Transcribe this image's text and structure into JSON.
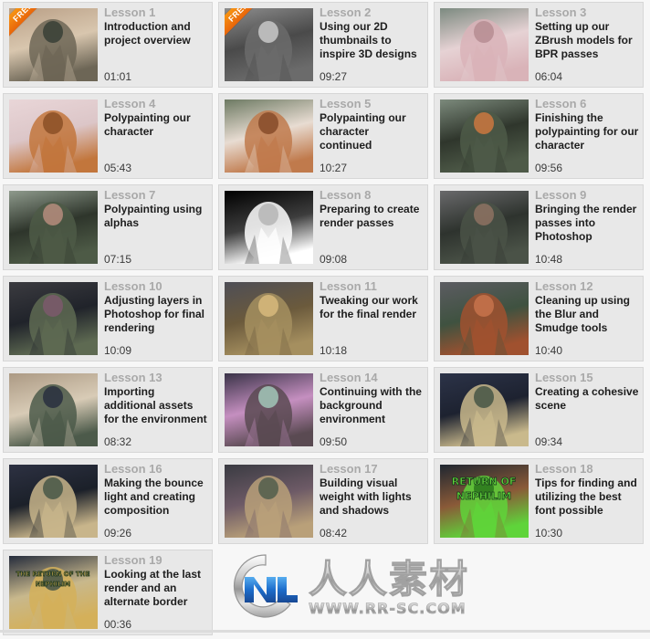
{
  "page": {
    "background_color": "#f7f7f7",
    "card_background": "#e8e8e8",
    "lesson_number_color": "#a9a9a9",
    "title_color": "#1e1e1e",
    "ribbon_color": "#ef7d10"
  },
  "free_badge_label": "FREE",
  "lessons": [
    {
      "number": "Lesson 1",
      "title": "Introduction and project overview",
      "duration": "01:01",
      "free": true,
      "thumb": "armored-creature-on-tan-sky",
      "palette": [
        "#b99f86",
        "#6d6656",
        "#3c4339",
        "#d8c6ae"
      ]
    },
    {
      "number": "Lesson 2",
      "title": "Using our 2D thumbnails to inspire 3D designs",
      "duration": "09:27",
      "free": true,
      "thumb": "grey-2d-weapon-thumbnails",
      "palette": [
        "#8d8d8d",
        "#6b6b6b",
        "#c3c3c3",
        "#4a4a4a"
      ]
    },
    {
      "number": "Lesson 3",
      "title": "Setting up our ZBrush models for BPR passes",
      "duration": "06:04",
      "free": false,
      "thumb": "pink-grey-zbrush-torso",
      "palette": [
        "#7c8a80",
        "#d9b3b8",
        "#b88f95",
        "#e6d2d4"
      ]
    },
    {
      "number": "Lesson 4",
      "title": "Polypainting our character",
      "duration": "05:43",
      "free": false,
      "thumb": "orange-creature-polypaint-ui",
      "palette": [
        "#e9d6d8",
        "#c2763c",
        "#8e5228",
        "#dcc6c8"
      ]
    },
    {
      "number": "Lesson 5",
      "title": "Polypainting our character continued",
      "duration": "10:27",
      "free": false,
      "thumb": "orange-creature-head-closeup",
      "palette": [
        "#6d7a63",
        "#c07a4c",
        "#8a4f2c",
        "#e8dcd2"
      ]
    },
    {
      "number": "Lesson 6",
      "title": "Finishing the polypainting for our character",
      "duration": "09:56",
      "free": false,
      "thumb": "green-armor-torso",
      "palette": [
        "#7c8a7c",
        "#4e5a48",
        "#c4763f",
        "#2f362c"
      ]
    },
    {
      "number": "Lesson 7",
      "title": "Polypainting using alphas",
      "duration": "07:15",
      "free": false,
      "thumb": "green-armor-torso-alphas",
      "palette": [
        "#8e9a8c",
        "#4d5a46",
        "#b0897a",
        "#2e352b"
      ]
    },
    {
      "number": "Lesson 8",
      "title": "Preparing to create render passes",
      "duration": "09:08",
      "free": false,
      "thumb": "black-white-render-pass",
      "palette": [
        "#000000",
        "#ffffff",
        "#b8b8b8",
        "#3d3d3d"
      ]
    },
    {
      "number": "Lesson 9",
      "title": "Bringing the render passes into Photoshop",
      "duration": "10:48",
      "free": false,
      "thumb": "creature-grey-background",
      "palette": [
        "#69696b",
        "#4a5247",
        "#8a7060",
        "#2e332e"
      ]
    },
    {
      "number": "Lesson 10",
      "title": "Adjusting layers in Photoshop for final rendering",
      "duration": "10:09",
      "free": false,
      "thumb": "dark-creature-layers",
      "palette": [
        "#3b3b40",
        "#5e6a52",
        "#7a5a6a",
        "#20232a"
      ]
    },
    {
      "number": "Lesson 11",
      "title": "Tweaking our work for the final render",
      "duration": "10:18",
      "free": false,
      "thumb": "closeup-tan-ridges",
      "palette": [
        "#4e4e56",
        "#a58f5f",
        "#d5b77a",
        "#6b5a3c"
      ]
    },
    {
      "number": "Lesson 12",
      "title": "Cleaning up using the Blur and Smudge tools",
      "duration": "10:40",
      "free": false,
      "thumb": "red-creature-grey-bg",
      "palette": [
        "#5c5c62",
        "#a0512f",
        "#c4714a",
        "#3f5240"
      ]
    },
    {
      "number": "Lesson 13",
      "title": "Importing additional assets for the environment",
      "duration": "08:32",
      "free": false,
      "thumb": "creature-snowy-environment",
      "palette": [
        "#ac9a84",
        "#4c5a4a",
        "#2c3340",
        "#d8cbb6"
      ]
    },
    {
      "number": "Lesson 14",
      "title": "Continuing with the background environment",
      "duration": "09:50",
      "free": false,
      "thumb": "creature-legs-night-scene",
      "palette": [
        "#3a3348",
        "#5a4a52",
        "#9fc0b4",
        "#c58fc0"
      ]
    },
    {
      "number": "Lesson 15",
      "title": "Creating a cohesive scene",
      "duration": "09:34",
      "free": false,
      "thumb": "creature-full-moon",
      "palette": [
        "#2c3348",
        "#c9b98c",
        "#4d5a49",
        "#1d2230"
      ]
    },
    {
      "number": "Lesson 16",
      "title": "Making the bounce light and creating composition",
      "duration": "09:26",
      "free": false,
      "thumb": "creature-moon-bounce-light",
      "palette": [
        "#2d3142",
        "#c8b58b",
        "#4e5b4a",
        "#1b2029"
      ]
    },
    {
      "number": "Lesson 17",
      "title": "Building visual weight with lights and shadows",
      "duration": "08:42",
      "free": false,
      "thumb": "creature-lights-shadows",
      "palette": [
        "#3a3b42",
        "#b9a079",
        "#56604f",
        "#6d5a66"
      ]
    },
    {
      "number": "Lesson 18",
      "title": "Tips for finding and utilizing the best font possible",
      "duration": "10:30",
      "free": false,
      "thumb": "return-of-nephilim-green-title",
      "palette": [
        "#1f2630",
        "#5fd43a",
        "#2d7a1e",
        "#8a5a38"
      ],
      "poster_text_line1": "RETURN OF",
      "poster_text_line2": "NEPHILIM"
    },
    {
      "number": "Lesson 19",
      "title": "Looking at the last render and an alternate border",
      "duration": "00:36",
      "free": false,
      "thumb": "the-return-of-the-nephilim-poster",
      "palette": [
        "#252c3c",
        "#d4b05a",
        "#4e5a49",
        "#c8b88c"
      ],
      "poster_text_line1": "THE RETURN OF THE",
      "poster_text_line2": "NEPHILIM"
    }
  ],
  "watermark": {
    "logo_letters": "NC",
    "chinese_text": "人人素材",
    "url_text": "WWW.RR-SC.COM"
  }
}
